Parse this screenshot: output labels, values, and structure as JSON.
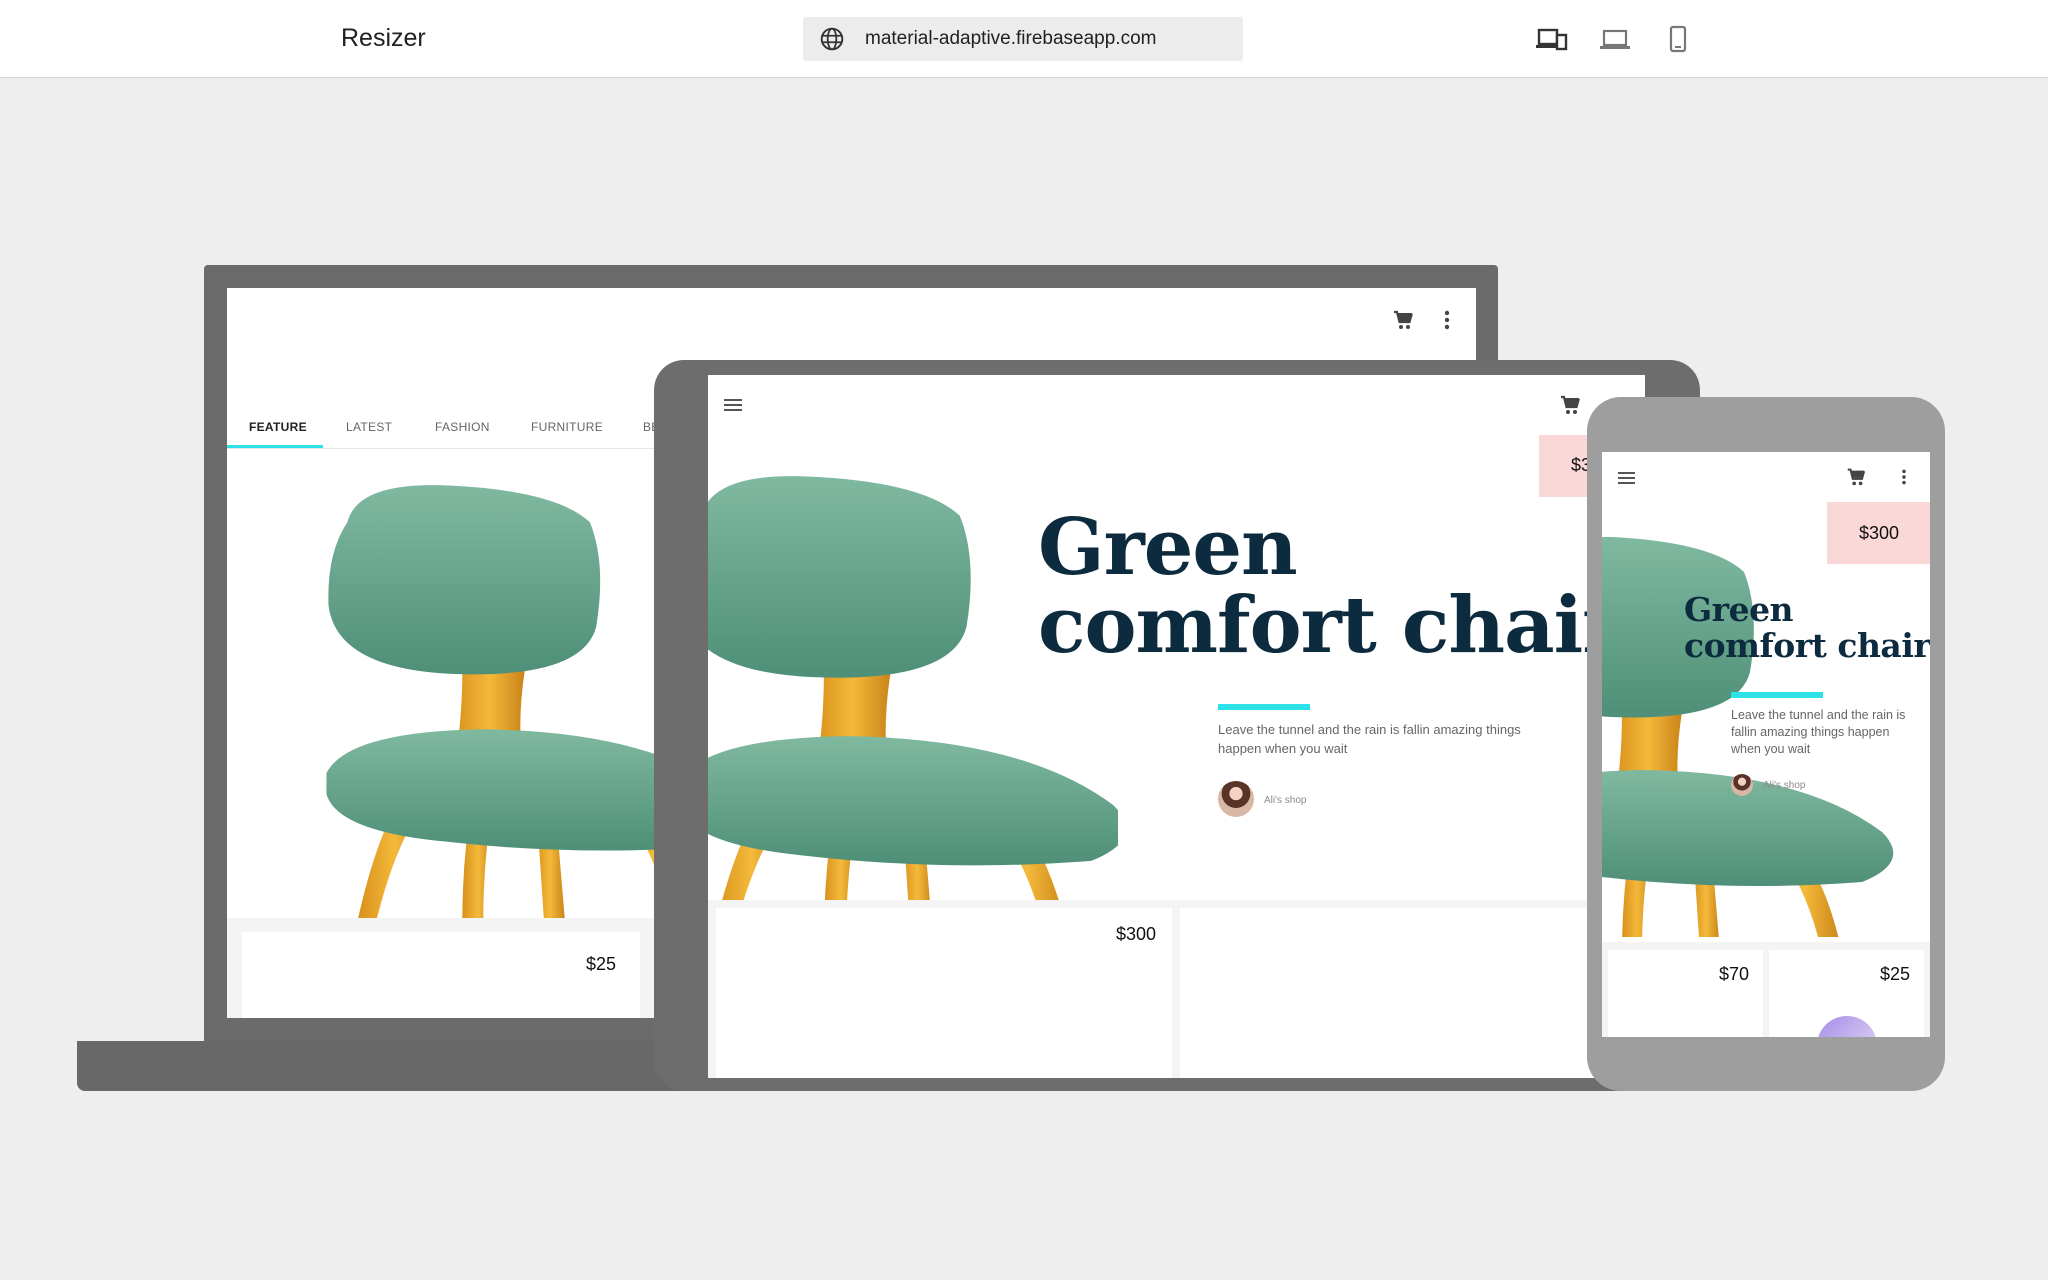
{
  "app": {
    "title": "Resizer"
  },
  "address_bar": {
    "url": "material-adaptive.firebaseapp.com"
  },
  "toolbar": {
    "icons": [
      "devices-icon",
      "laptop-icon",
      "phone-icon"
    ]
  },
  "laptop": {
    "tabs": [
      "FEATURE",
      "LATEST",
      "FASHION",
      "FURNITURE",
      "BE"
    ],
    "active_tab": "FEATURE",
    "card_price": "$25"
  },
  "tablet": {
    "hero_price": "$3",
    "title_line1": "Green",
    "title_line2": "comfort chair",
    "description": "Leave the tunnel and the rain is fallin amazing things happen when you wait",
    "shop": "Ali's shop",
    "card_price": "$300"
  },
  "phone": {
    "hero_price": "$300",
    "title_line1": "Green",
    "title_line2": "comfort chair",
    "description": "Leave the tunnel and the rain is fallin amazing things happen when you wait",
    "shop": "Ali's shop",
    "card_prices": [
      "$70",
      "$25"
    ]
  },
  "colors": {
    "accent": "#2de1e6",
    "title": "#0d2b3e",
    "price_badge": "#fbd8d8",
    "frame_dark": "#6b6b6b",
    "frame_light": "#9e9e9e",
    "background": "#eeeeee"
  }
}
